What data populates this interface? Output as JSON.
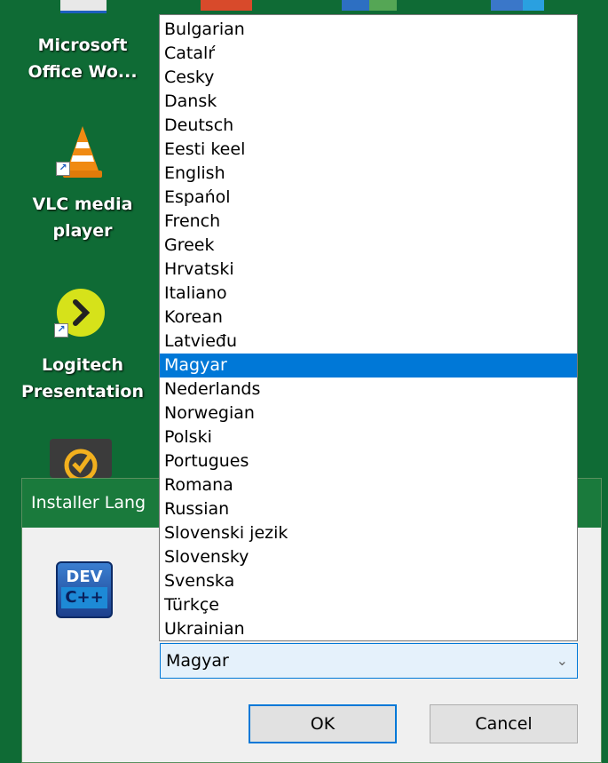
{
  "desktop": {
    "icons": [
      {
        "label_line1": "Microsoft",
        "label_line2": "Office Wo..."
      },
      {
        "label_line1": "VLC media",
        "label_line2": "player"
      },
      {
        "label_line1": "Logitech",
        "label_line2": "Presentation"
      }
    ],
    "shortcut_arrow": "↗"
  },
  "dialog": {
    "title": "Installer Lang",
    "logo_top": "DEV",
    "logo_bottom": "C++",
    "selected_language": "Magyar",
    "ok_label": "OK",
    "cancel_label": "Cancel"
  },
  "dropdown": {
    "items": [
      "Bulgarian",
      "Catalŕ",
      "Cesky",
      "Dansk",
      "Deutsch",
      "Eesti keel",
      "English",
      "Espańol",
      "French",
      "Greek",
      "Hrvatski",
      "Italiano",
      "Korean",
      "Latvieđu",
      "Magyar",
      "Nederlands",
      "Norwegian",
      "Polski",
      "Portugues",
      "Romana",
      "Russian",
      "Slovenski jezik",
      "Slovensky",
      "Svenska",
      "Türkçe",
      "Ukrainian"
    ],
    "selected_index": 14
  },
  "colors": {
    "desktop_bg": "#0f6b35",
    "titlebar": "#1a7a3c",
    "selection": "#0078d7"
  }
}
